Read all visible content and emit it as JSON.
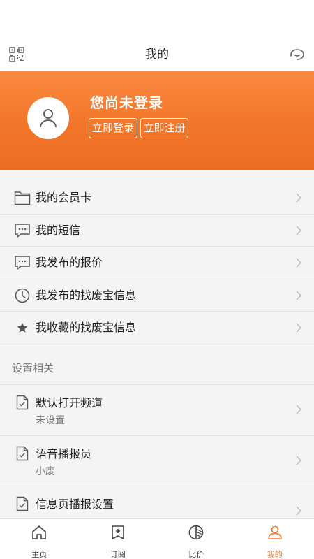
{
  "header": {
    "title": "我的",
    "left_icon": "qr-code-icon",
    "right_icon": "customer-service-icon"
  },
  "profile": {
    "status_text": "您尚未登录",
    "login_label": "立即登录",
    "register_label": "立即注册",
    "avatar_icon": "user-icon",
    "accent_color": "#f2762a"
  },
  "menu": [
    {
      "label": "我的会员卡",
      "icon": "folder-icon"
    },
    {
      "label": "我的短信",
      "icon": "message-icon"
    },
    {
      "label": "我发布的报价",
      "icon": "message-icon"
    },
    {
      "label": "我发布的找废宝信息",
      "icon": "clock-icon"
    },
    {
      "label": "我收藏的找废宝信息",
      "icon": "star-icon"
    }
  ],
  "settings": {
    "title": "设置相关",
    "items": [
      {
        "label": "默认打开频道",
        "value": "未设置"
      },
      {
        "label": "语音播报员",
        "value": "小废"
      },
      {
        "label": "信息页播报设置",
        "value": ""
      }
    ]
  },
  "tabs": [
    {
      "label": "主页",
      "icon": "home-icon",
      "active": false
    },
    {
      "label": "订阅",
      "icon": "subscribe-icon",
      "active": false
    },
    {
      "label": "比价",
      "icon": "compare-icon",
      "active": false
    },
    {
      "label": "我的",
      "icon": "profile-icon",
      "active": true
    }
  ]
}
